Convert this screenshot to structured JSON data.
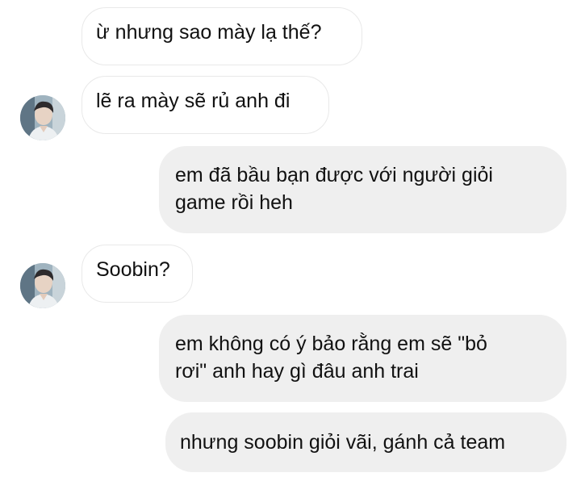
{
  "messages": [
    {
      "direction": "incoming",
      "text": "ừ nhưng sao mày lạ thế?"
    },
    {
      "direction": "incoming",
      "text": "lẽ ra mày sẽ rủ anh đi"
    },
    {
      "direction": "outgoing",
      "lines": [
        "em đã bầu bạn được với người giỏi",
        "game rồi heh"
      ]
    },
    {
      "direction": "incoming",
      "text": "Soobin?"
    },
    {
      "direction": "outgoing",
      "lines": [
        "em không có ý bảo rằng em sẽ \"bỏ",
        "rơi\" anh hay gì đâu anh trai"
      ]
    },
    {
      "direction": "outgoing",
      "text": "nhưng soobin giỏi vãi, gánh cả team"
    }
  ],
  "colors": {
    "incoming_bg": "#ffffff",
    "incoming_border": "#e9e9e9",
    "outgoing_bg": "#efefef",
    "text": "#111111"
  },
  "avatar": {
    "icon": "contact-avatar-photo"
  }
}
